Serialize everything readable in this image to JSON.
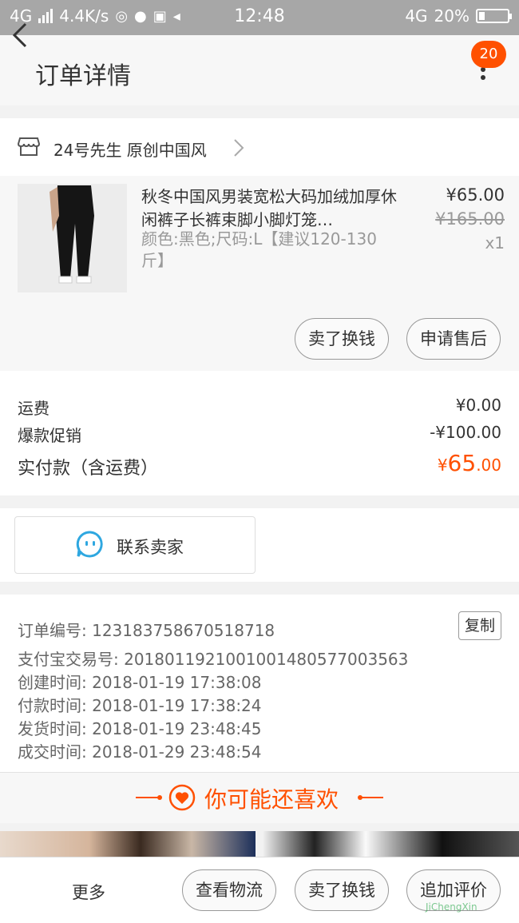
{
  "status_bar": {
    "network_left": "4G",
    "speed": "4.4K/s",
    "time": "12:48",
    "network_right": "4G",
    "battery": "20%"
  },
  "header": {
    "title": "订单详情",
    "badge_count": "20"
  },
  "shop": {
    "name": "24号先生 原创中国风"
  },
  "product": {
    "title": "秋冬中国风男装宽松大码加绒加厚休闲裤子长裤束脚小脚灯笼…",
    "sku": "颜色:黑色;尺码:L【建议120-130斤】",
    "price": "¥65.00",
    "original_price": "¥165.00",
    "quantity": "x1",
    "buttons": {
      "sell": "卖了换钱",
      "after_sale": "申请售后"
    }
  },
  "fees": {
    "shipping_label": "运费",
    "shipping_value": "¥0.00",
    "promo_label": "爆款促销",
    "promo_value": "-¥100.00",
    "paid_label": "实付款（含运费）",
    "paid_currency": "¥",
    "paid_int": "65",
    "paid_dec": ".00"
  },
  "contact": {
    "label": "联系卖家"
  },
  "order_info": {
    "order_no": "订单编号: 123183758670518718",
    "alipay_no": "支付宝交易号: 2018011921001001480577003563",
    "created": "创建时间: 2018-01-19 17:38:08",
    "paid": "付款时间: 2018-01-19 17:38:24",
    "shipped": "发货时间: 2018-01-19 23:48:45",
    "completed": "成交时间: 2018-01-29 23:48:54",
    "copy": "复制"
  },
  "guess": {
    "text": "你可能还喜欢"
  },
  "bottom_bar": {
    "more": "更多",
    "logistics": "查看物流",
    "sell": "卖了换钱",
    "review": "追加评价"
  },
  "watermark": "JiChengXin",
  "colors": {
    "accent": "#ff5000",
    "chat_icon": "#2ea7e0"
  }
}
